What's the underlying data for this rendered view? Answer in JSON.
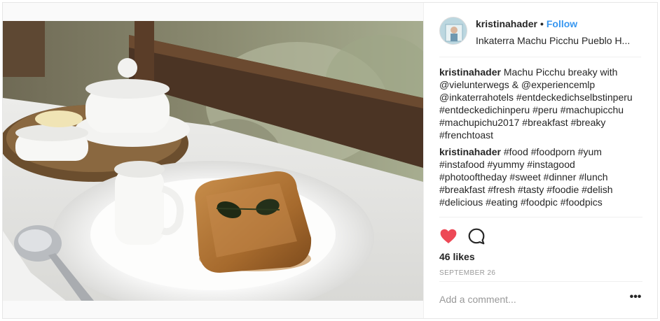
{
  "post": {
    "username": "kristinahader",
    "separator": "•",
    "follow_label": "Follow",
    "location": "Inkaterra Machu Picchu Pueblo H...",
    "comments": [
      {
        "user": "kristinahader",
        "text": "Machu Picchu breaky with @vielunterwegs & @experiencemlp @inkaterrahotels #entdeckedichselbstinperu #entdeckedichinperu #peru #machupicchu #machupichu2017 #breakfast #breaky #frenchtoast"
      },
      {
        "user": "kristinahader",
        "text": "#food #foodporn #yum #instafood #yummy #instagood #photooftheday #sweet #dinner #lunch #breakfast #fresh #tasty #foodie #delish #delicious #eating #foodpic #foodpics"
      }
    ],
    "likes": "46 likes",
    "date": "SEPTEMBER 26",
    "comment_placeholder": "Add a comment...",
    "more_label": "•••"
  },
  "icons": {
    "heart": "heart-icon",
    "comment": "comment-icon",
    "more": "more-options-icon"
  },
  "colors": {
    "accent": "#3897f0",
    "heart": "#ed4956",
    "border": "#efefef"
  }
}
